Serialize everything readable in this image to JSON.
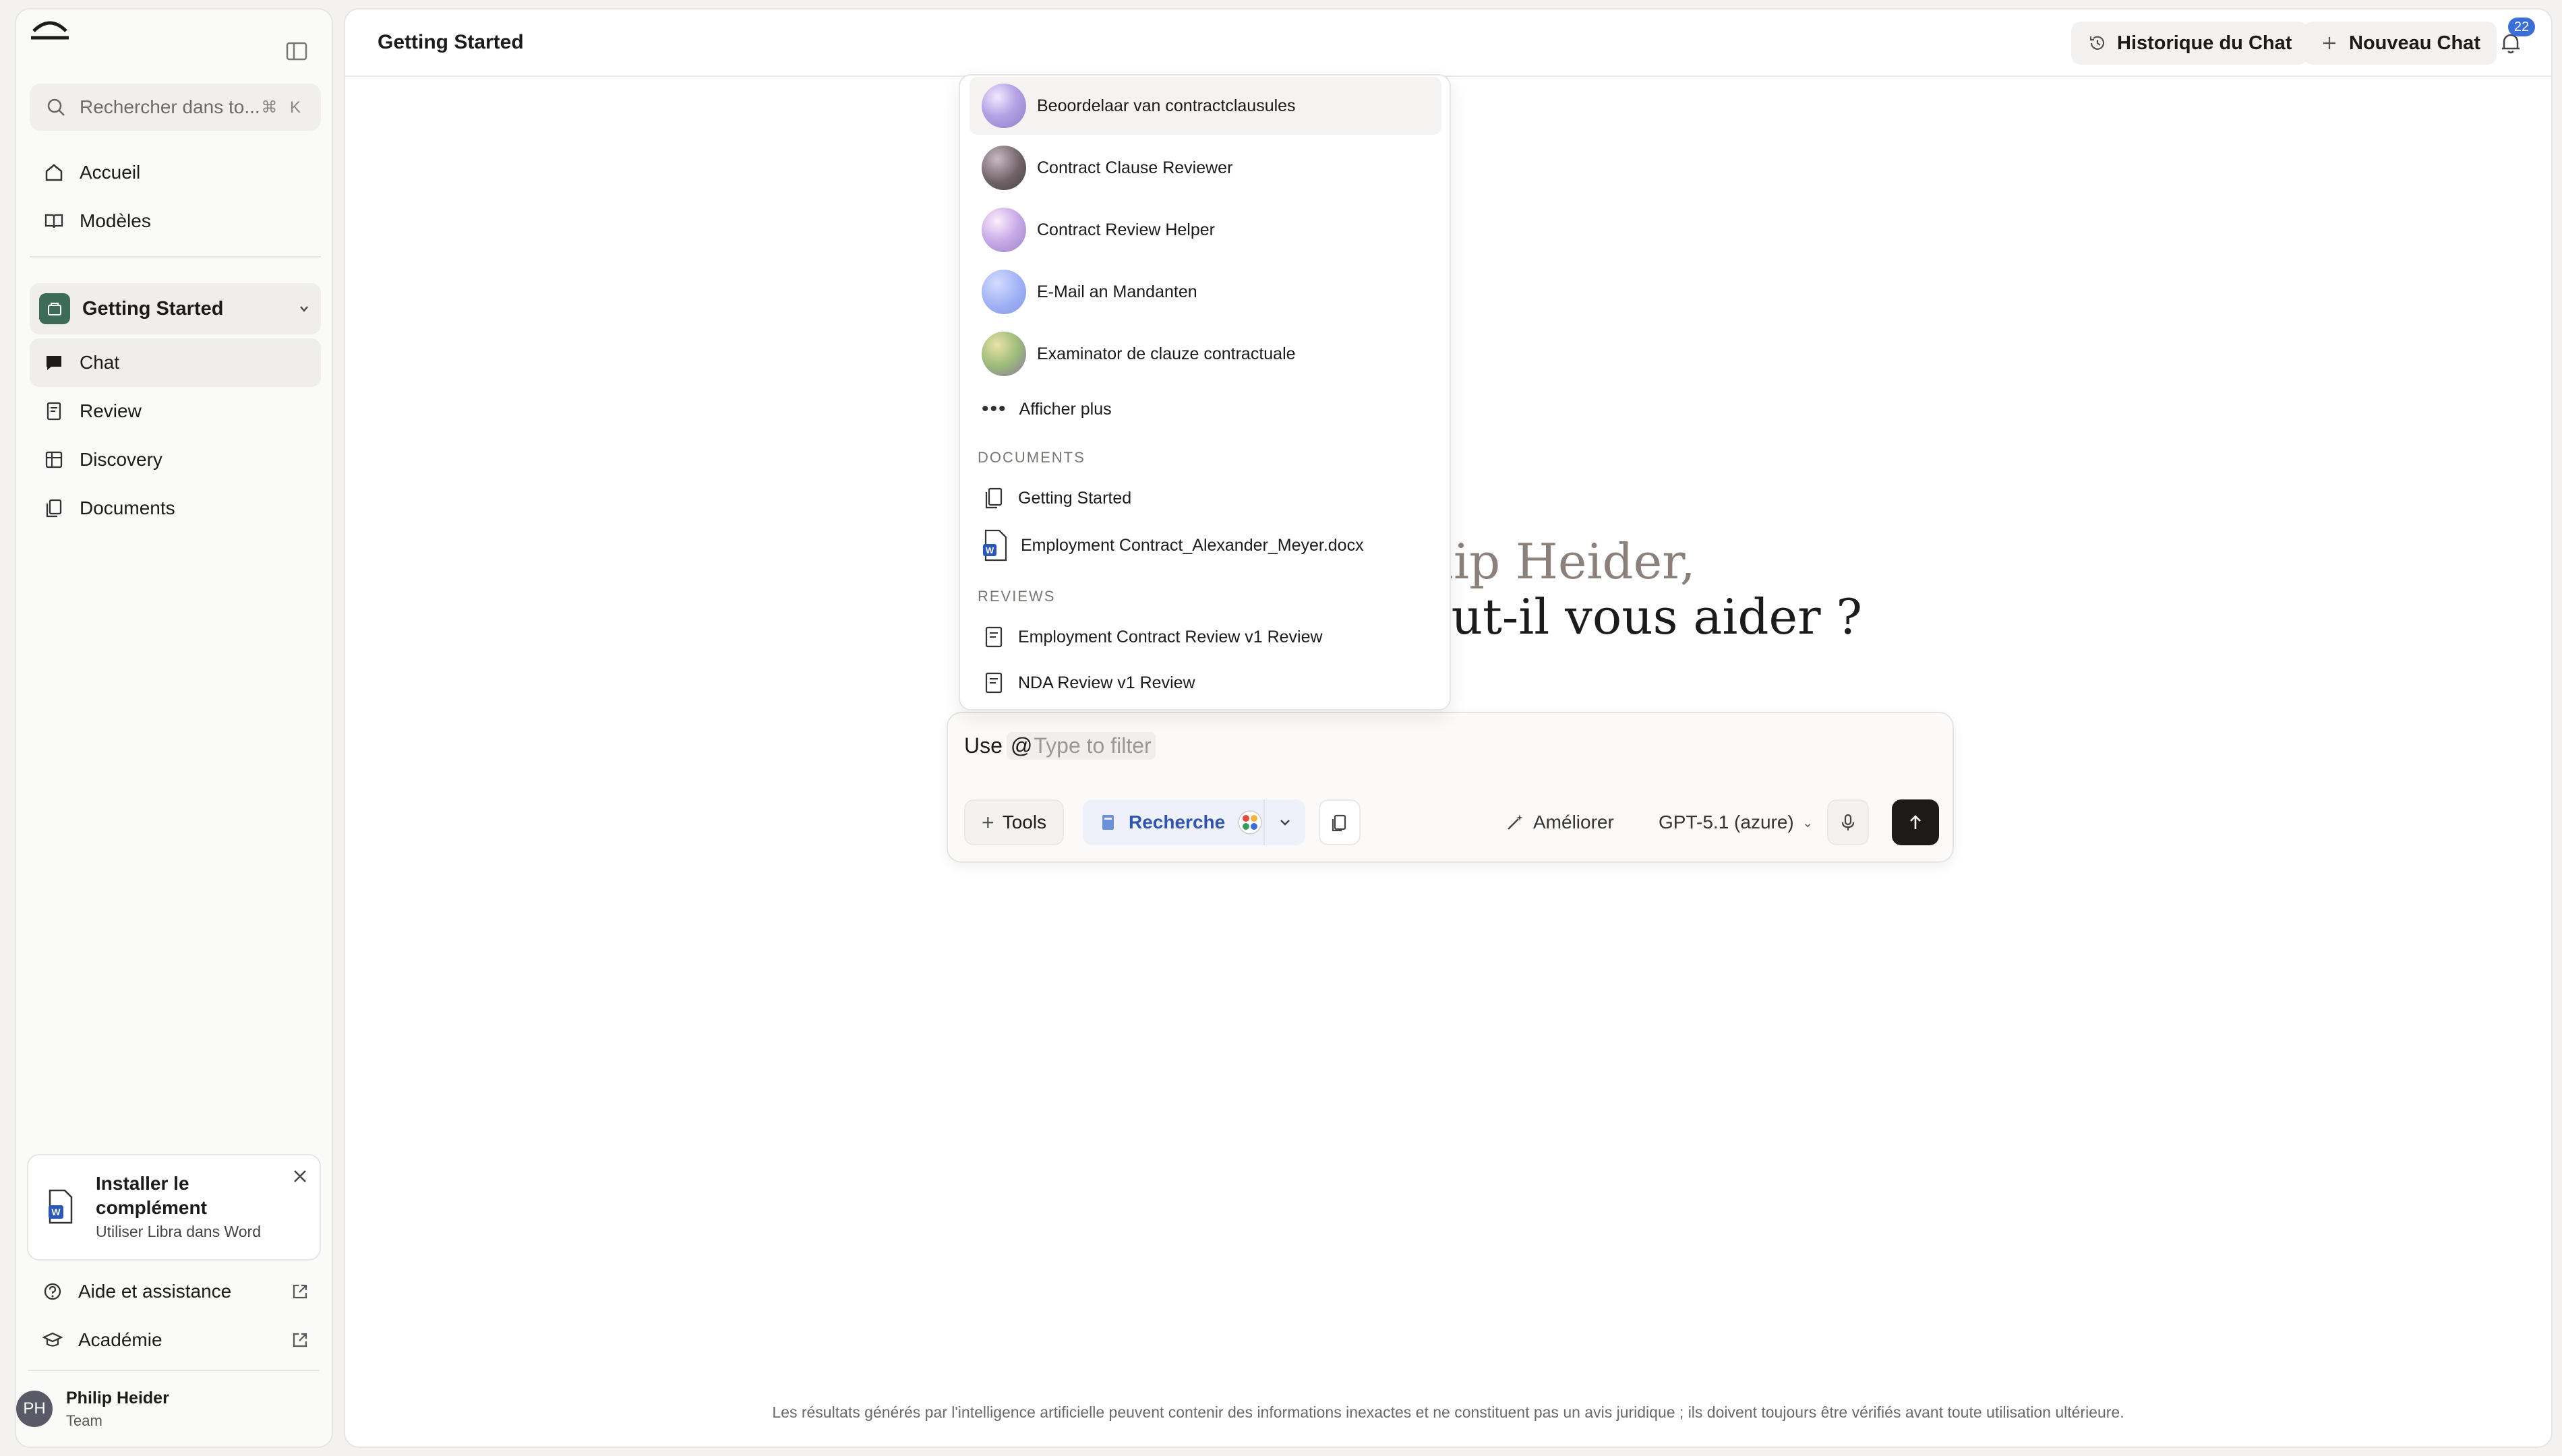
{
  "sidebar": {
    "search": {
      "placeholder": "Rechercher dans to...",
      "shortcut": "⌘ K"
    },
    "nav_top": [
      {
        "label": "Accueil",
        "icon": "home-icon"
      },
      {
        "label": "Modèles",
        "icon": "book-icon"
      }
    ],
    "workspace": {
      "label": "Getting Started"
    },
    "nav_ws": [
      {
        "label": "Chat",
        "icon": "chat-icon",
        "active": true
      },
      {
        "label": "Review",
        "icon": "review-icon"
      },
      {
        "label": "Discovery",
        "icon": "table-icon"
      },
      {
        "label": "Documents",
        "icon": "documents-icon"
      }
    ],
    "promo": {
      "title": "Installer le complément",
      "subtitle": "Utiliser Libra dans Word"
    },
    "footer": [
      {
        "label": "Aide et assistance",
        "icon": "help-icon"
      },
      {
        "label": "Académie",
        "icon": "academy-icon"
      }
    ],
    "user": {
      "initials": "PH",
      "name": "Philip Heider",
      "role": "Team"
    }
  },
  "header": {
    "title": "Getting Started",
    "history_label": "Historique du Chat",
    "new_chat_label": "Nouveau Chat",
    "notification_count": "22"
  },
  "greeting": {
    "line1": "ilip Heider,",
    "line2": "eut-il vous aider ?"
  },
  "composer": {
    "prefix": "Use",
    "mention_at": "@",
    "mention_placeholder": "Type to filter",
    "tools_label": "Tools",
    "research_label": "Recherche",
    "improve_label": "Améliorer",
    "model_label": "GPT-5.1 (azure)"
  },
  "dropdown": {
    "assistants": [
      {
        "label": "Beoordelaar van contractclausules"
      },
      {
        "label": "Contract Clause Reviewer"
      },
      {
        "label": "Contract Review Helper"
      },
      {
        "label": "E-Mail an Mandanten"
      },
      {
        "label": "Examinator de clauze contractuale"
      }
    ],
    "show_more": "Afficher plus",
    "documents_header": "DOCUMENTS",
    "documents": [
      {
        "label": "Getting Started",
        "icon": "folder-doc-icon"
      },
      {
        "label": "Employment Contract_Alexander_Meyer.docx",
        "icon": "word-doc-icon"
      }
    ],
    "reviews_header": "REVIEWS",
    "reviews": [
      {
        "label": "Employment Contract Review v1 Review",
        "icon": "review-icon"
      },
      {
        "label": "NDA Review v1 Review",
        "icon": "review-icon"
      }
    ]
  },
  "disclaimer": "Les résultats générés par l'intelligence artificielle peuvent contenir des informations inexactes et ne constituent pas un avis juridique ; ils doivent toujours être vérifiés avant toute utilisation ultérieure.",
  "colors": {
    "accent": "#3b6fd8",
    "workspace": "#3d6b5a",
    "send": "#1c1b1a"
  }
}
